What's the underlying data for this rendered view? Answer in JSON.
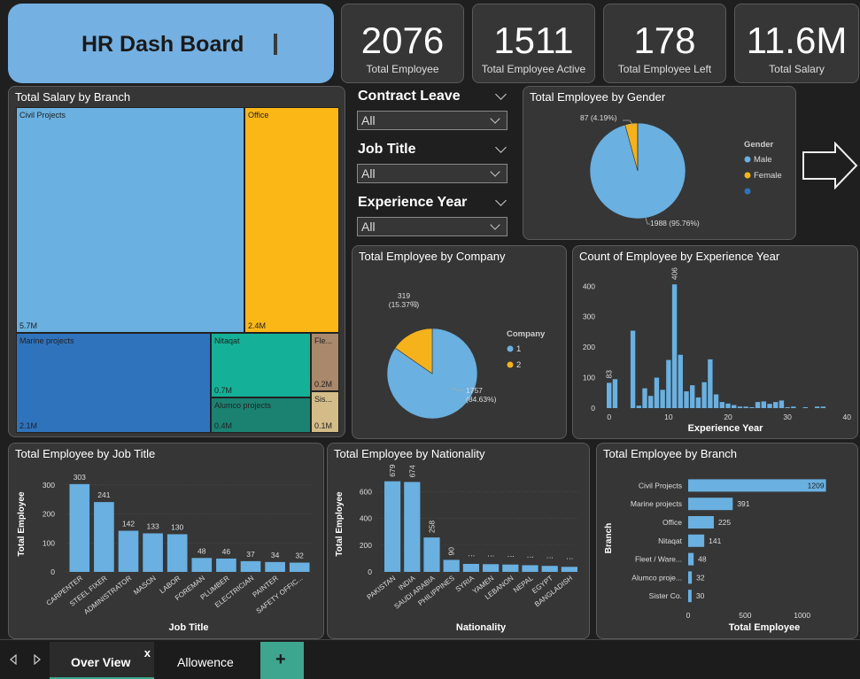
{
  "dashboard": {
    "title": "HR Dash Board"
  },
  "kpis": [
    {
      "value": "2076",
      "label": "Total Employee"
    },
    {
      "value": "1511",
      "label": "Total Employee Active"
    },
    {
      "value": "178",
      "label": "Total Employee Left"
    },
    {
      "value": "11.6M",
      "label": "Total Salary"
    }
  ],
  "filters": [
    {
      "label": "Contract Leave",
      "value": "All"
    },
    {
      "label": "Job Title",
      "value": "All"
    },
    {
      "label": "Experience Year",
      "value": "All"
    }
  ],
  "colors": {
    "blue": "#6ab0e0",
    "orange": "#f5b21a",
    "panel": "#363636",
    "title_card": "#74b0e1",
    "accent_tab": "#3ea58f"
  },
  "tabs": [
    {
      "label": "Over View",
      "close": "x"
    },
    {
      "label": "Allowence"
    },
    {
      "label": "+"
    }
  ],
  "chart_data": [
    {
      "type": "treemap",
      "title": "Total Salary by Branch",
      "items": [
        {
          "name": "Civil Projects",
          "label": "5.7M",
          "value": 5.7,
          "color": "#6ab0e0"
        },
        {
          "name": "Office",
          "label": "2.4M",
          "value": 2.4,
          "color": "#fbb716"
        },
        {
          "name": "Marine projects",
          "label": "2.1M",
          "value": 2.1,
          "color": "#2f73bd"
        },
        {
          "name": "Nitaqat",
          "label": "0.7M",
          "value": 0.7,
          "color": "#14b097"
        },
        {
          "name": "Fle...",
          "label": "0.2M",
          "value": 0.2,
          "color": "#a9886b"
        },
        {
          "name": "Alumco projects",
          "label": "0.4M",
          "value": 0.4,
          "color": "#1b8272"
        },
        {
          "name": "Sis...",
          "label": "0.1M",
          "value": 0.1,
          "color": "#d4bc88"
        }
      ]
    },
    {
      "type": "pie",
      "title": "Total Employee by Gender",
      "legend_title": "Gender",
      "slices": [
        {
          "name": "Male",
          "value": 1988,
          "label": "1988 (95.76%)",
          "color": "#6ab0e0"
        },
        {
          "name": "Female",
          "value": 87,
          "label": "87 (4.19%)",
          "color": "#f5b21a"
        },
        {
          "name": "",
          "value": 1,
          "label": "",
          "color": "#2f73bd"
        }
      ]
    },
    {
      "type": "pie",
      "title": "Total Employee by Company",
      "legend_title": "Company",
      "slices": [
        {
          "name": "1",
          "value": 1757,
          "label": "1757 (84.63%)",
          "color": "#6ab0e0"
        },
        {
          "name": "2",
          "value": 319,
          "label": "319 (15.37%)",
          "color": "#f5b21a"
        }
      ]
    },
    {
      "type": "bar",
      "title": "Count of Employee by Experience Year",
      "xlabel": "Experience Year",
      "x_ticks": [
        "0",
        "10",
        "20",
        "30",
        "40"
      ],
      "y_ticks": [
        "0",
        "100",
        "200",
        "300",
        "400"
      ],
      "ylim": [
        0,
        430
      ],
      "xlim": [
        -1,
        41
      ],
      "x": [
        0,
        1,
        4,
        5,
        6,
        7,
        8,
        9,
        10,
        11,
        12,
        13,
        14,
        15,
        16,
        17,
        18,
        19,
        20,
        21,
        22,
        23,
        24,
        25,
        26,
        27,
        28,
        29,
        30,
        31,
        32,
        33,
        35,
        36
      ],
      "values": [
        83,
        95,
        254,
        8,
        65,
        40,
        100,
        60,
        158,
        406,
        175,
        55,
        75,
        35,
        85,
        160,
        45,
        20,
        15,
        10,
        5,
        5,
        3,
        20,
        22,
        14,
        20,
        25,
        3,
        5,
        0,
        3,
        5,
        5
      ],
      "data_labels": [
        {
          "x": 0,
          "text": "83"
        },
        {
          "x": 11,
          "text": "406"
        }
      ]
    },
    {
      "type": "bar",
      "title": "Total Employee by Job Title",
      "xlabel": "Job Title",
      "ylabel": "Total Employee",
      "y_ticks": [
        "0",
        "100",
        "200",
        "300"
      ],
      "ylim": [
        0,
        330
      ],
      "categories": [
        "CARPENTER",
        "STEEL FIXER",
        "ADMINISTRATOR",
        "MASON",
        "LABOR",
        "FOREMAN",
        "PLUMBER",
        "ELECTRICIAN",
        "PAINTER",
        "SAFETY OFFIC..."
      ],
      "values": [
        303,
        241,
        142,
        133,
        130,
        48,
        46,
        37,
        34,
        32
      ]
    },
    {
      "type": "bar",
      "title": "Total Employee by Nationality",
      "xlabel": "Nationality",
      "ylabel": "Total Employee",
      "y_ticks": [
        "0",
        "200",
        "400",
        "600"
      ],
      "ylim": [
        0,
        730
      ],
      "categories": [
        "PAKISTAN",
        "INDIA",
        "SAUDI ARABIA",
        "PHILIPPINES",
        "SYRIA",
        "YAMEN",
        "LEBANON",
        "NEPAL",
        "EGYPT",
        "BANGLADISH"
      ],
      "values": [
        679,
        674,
        258,
        90,
        60,
        58,
        55,
        50,
        45,
        38
      ],
      "data_labels": [
        "679",
        "674",
        "258",
        "90",
        "⋮",
        "⋮",
        "⋮",
        "⋮",
        "⋮",
        "⋮"
      ]
    },
    {
      "type": "hbar",
      "title": "Total Employee by Branch",
      "xlabel": "Total Employee",
      "ylabel": "Branch",
      "x_ticks": [
        "0",
        "500",
        "1000"
      ],
      "xlim": [
        0,
        1220
      ],
      "categories": [
        "Civil Projects",
        "Marine projects",
        "Office",
        "Nitaqat",
        "Fleet / Ware...",
        "Alumco proje...",
        "Sister Co."
      ],
      "values": [
        1209,
        391,
        225,
        141,
        48,
        32,
        30
      ]
    }
  ]
}
